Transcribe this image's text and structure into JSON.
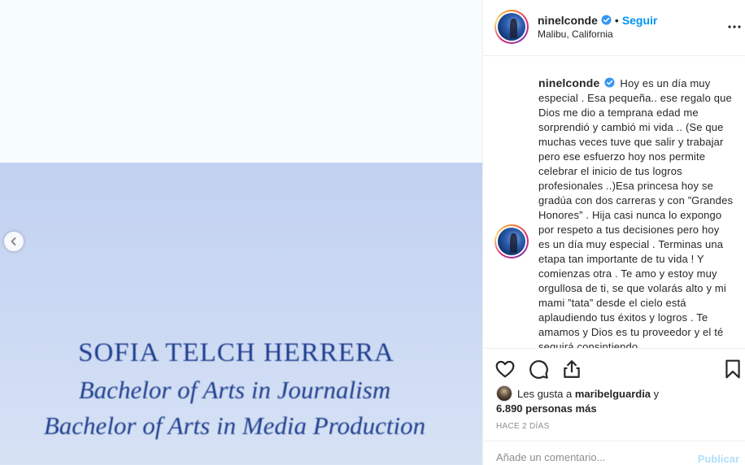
{
  "media": {
    "diploma": {
      "name": "SOFIA TELCH HERRERA",
      "degree1": "Bachelor of Arts in Journalism",
      "degree2": "Bachelor of Arts in Media Production"
    }
  },
  "header": {
    "username": "ninelconde",
    "follow_label": "Seguir",
    "dot": "•",
    "location": "Malibu, California"
  },
  "caption": {
    "username": "ninelconde",
    "text": "Hoy es un día muy especial . Esa pequeña.. ese regalo que Dios me dio a temprana edad me sorprendió y cambió mi vida .. (Se que muchas veces tuve que salir y trabajar pero ese esfuerzo hoy nos permite celebrar el inicio de tus logros profesionales ..)Esa princesa hoy se gradúa con dos carreras y con ”Grandes Honores” . Hija casi nunca lo expongo por respeto a tus decisiones pero hoy es un día muy especial . Terminas una etapa tan importante de tu vida ! Y comienzas otra . Te amo y estoy muy orgullosa de ti, se que volarás alto y mi mami ”tata” desde el cielo está aplaudiendo tus éxitos y logros . Te amamos y Dios es tu proveedor y el té seguirá consintiendo"
  },
  "likes": {
    "prefix": "Les gusta a",
    "liker": "maribelguardia",
    "conj": "y",
    "count": "6.890 personas más"
  },
  "timestamp": "Hace 2 días",
  "comment": {
    "placeholder": "Añade un comentario...",
    "publish_label": "Publicar"
  },
  "colors": {
    "accent": "#0095f6",
    "verified": "#3897f0",
    "publish_disabled": "#b2dffc",
    "muted": "#8e8e8e"
  },
  "icons": [
    "chevron-left-icon",
    "verified-icon",
    "more-icon",
    "heart-icon",
    "comment-icon",
    "share-icon",
    "bookmark-icon"
  ]
}
